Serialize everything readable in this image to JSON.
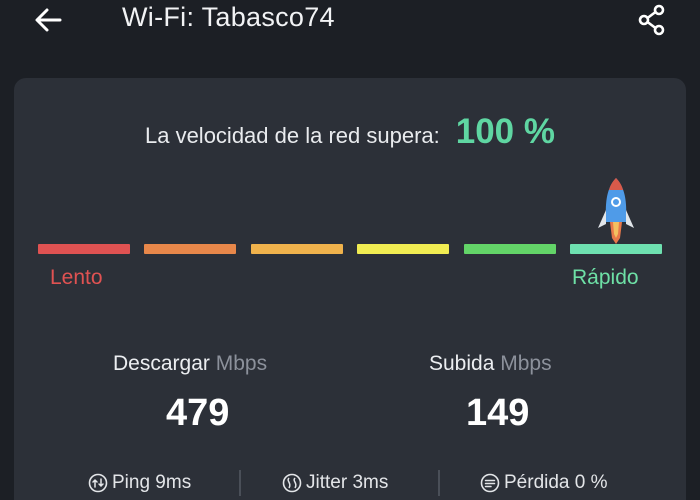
{
  "header": {
    "title": "Wi-Fi: Tabasco74",
    "back_icon": "arrow-left-icon",
    "share_icon": "share-icon"
  },
  "speed": {
    "label": "La velocidad de la red supera:",
    "value": "100 %",
    "value_color": "#5fd6a2",
    "percent": 100
  },
  "scale": {
    "slow_label": "Lento",
    "fast_label": "Rápido",
    "segments": [
      "#e05252",
      "#e8874a",
      "#f0b24c",
      "#f1ec52",
      "#63d468",
      "#6ee0b0"
    ]
  },
  "metrics": {
    "download": {
      "label": "Descargar",
      "unit": "Mbps",
      "value": "479"
    },
    "upload": {
      "label": "Subida",
      "unit": "Mbps",
      "value": "149"
    }
  },
  "stats": {
    "ping": "Ping 9ms",
    "jitter": "Jitter 3ms",
    "loss": "Pérdida 0 %"
  }
}
